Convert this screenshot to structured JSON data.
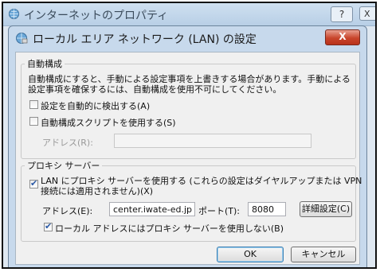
{
  "back_window": {
    "title": "インターネットのプロパティ",
    "help_label": "?",
    "close_label": "X"
  },
  "dialog": {
    "title": "ローカル エリア ネットワーク (LAN) の設定",
    "close_label": "X"
  },
  "auto_config": {
    "legend": "自動構成",
    "description_line1": "自動構成にすると、手動による設定事項を上書きする場合があります。手動による",
    "description_line2": "設定事項を確保するには、自動構成を使用不可にしてください。",
    "auto_detect_label": "設定を自動的に検出する(A)",
    "auto_detect_checked": false,
    "script_label": "自動構成スクリプトを使用する(S)",
    "script_checked": false,
    "address_label": "アドレス(R):",
    "address_value": ""
  },
  "proxy": {
    "legend": "プロキシ サーバー",
    "use_proxy_line1": "LAN にプロキシ サーバーを使用する (これらの設定はダイヤルアップまたは VPN",
    "use_proxy_line2": "接続には適用されません)(X)",
    "use_proxy_checked": true,
    "address_label": "アドレス(E):",
    "address_value": "center.iwate-ed.jp",
    "port_label": "ポート(T):",
    "port_value": "8080",
    "advanced_label": "詳細設定(C)",
    "bypass_label": "ローカル アドレスにはプロキシ サーバーを使用しない(B)",
    "bypass_checked": true
  },
  "footer": {
    "ok_label": "OK",
    "cancel_label": "キャンセル"
  }
}
